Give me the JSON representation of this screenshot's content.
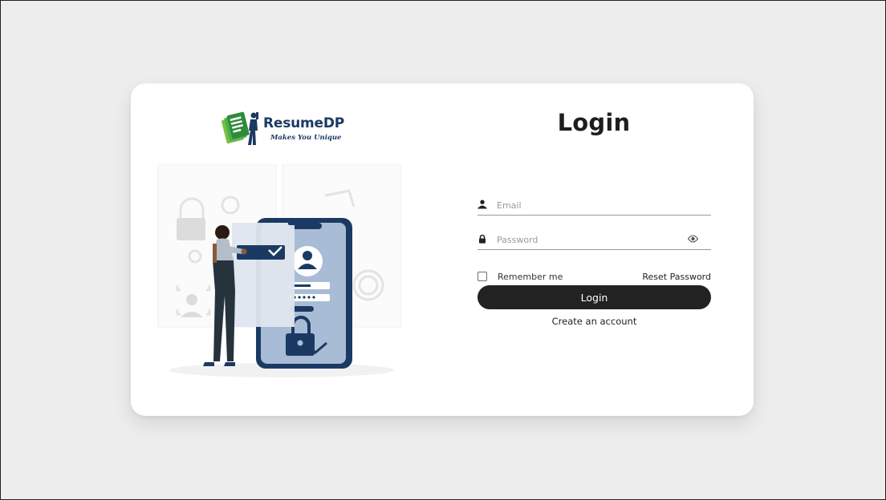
{
  "brand": {
    "name": "ResumeDP",
    "tagline": "Makes You Unique",
    "primary_color": "#1b3a63",
    "accent_green": "#4caf50"
  },
  "form": {
    "title": "Login",
    "email": {
      "placeholder": "Email",
      "value": "",
      "icon": "user-icon"
    },
    "password": {
      "placeholder": "Password",
      "value": "",
      "icon": "lock-icon",
      "toggle_icon": "eye-icon"
    },
    "remember_label": "Remember me",
    "remember_checked": false,
    "reset_label": "Reset Password",
    "submit_label": "Login",
    "create_account_label": "Create an account",
    "button_color": "#222222"
  },
  "illustration": {
    "icon": "secure-login-illustration"
  }
}
